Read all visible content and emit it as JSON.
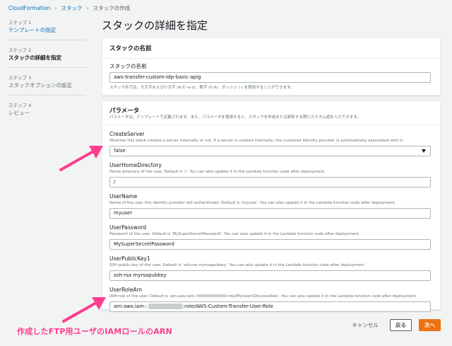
{
  "breadcrumb": {
    "item1": "CloudFormation",
    "item2": "スタック",
    "item3": "スタックの作成"
  },
  "steps": [
    {
      "num": "ステップ 1",
      "name": "テンプレートの指定"
    },
    {
      "num": "ステップ 2",
      "name": "スタックの詳細を指定"
    },
    {
      "num": "ステップ 3",
      "name": "スタックオプションの設定"
    },
    {
      "num": "ステップ 4",
      "name": "レビュー"
    }
  ],
  "page_title": "スタックの詳細を指定",
  "stack_name_panel": {
    "header": "スタックの名前",
    "label": "スタックの名前",
    "value": "aws-transfer-custom-idp-basic-apig",
    "hint": "スタック名では、大文字および小文字 (A-Z~a-z)、数字 (0-9)、ダッシュ (-) を使用することができます。"
  },
  "params_panel": {
    "header": "パラメータ",
    "desc": "パラメータは、テンプレートで定義されます。また、パラメータを使用すると、スタックを作成または更新する際にカスタム値を入力できます。",
    "params": [
      {
        "label": "CreateServer",
        "desc": "Whether this stack creates a server internally or not. If a server is created internally, the customer identity provider is automatically associated with it.",
        "value": "false"
      },
      {
        "label": "UserHomeDirectory",
        "desc": "Home directory of the user. Default is '/'. You can also update it in the Lambda function code after deployment.",
        "value": "/"
      },
      {
        "label": "UserName",
        "desc": "Name of the user this identity provider will authenticate. Default is 'myuser'. You can also update it in the Lambda function code after deployment.",
        "value": "myuser"
      },
      {
        "label": "UserPassword",
        "desc": "Password of the user. Default is 'MySuperSecretPassword'. You can also update it in the Lambda function code after deployment.",
        "value": "MySuperSecretPassword"
      },
      {
        "label": "UserPublicKey1",
        "desc": "SSH public key of the user. Default is 'ssh-rsa mynsapubkey'. You can also update it in the Lambda function code after deployment.",
        "value": "ssh-rsa myrsapubkey"
      },
      {
        "label": "UserRoleArn",
        "desc": "IAM role of the user. Default is 'arn:aws:iam::000000000000:role/MyUserS3AccessRole'. You can also update it in the Lambda function code after deployment.",
        "value_prefix": "arn:aws:iam::",
        "value_suffix": ":role/AWS-Custom-Transfer-User-Role"
      }
    ]
  },
  "footer": {
    "cancel": "キャンセル",
    "back": "戻る",
    "next": "次へ"
  },
  "annotation": "作成したFTP用ユーザのIAMロールのARN",
  "colors": {
    "link": "#0073bb",
    "primary": "#ec7211",
    "annotation": "#ff3c8e"
  }
}
